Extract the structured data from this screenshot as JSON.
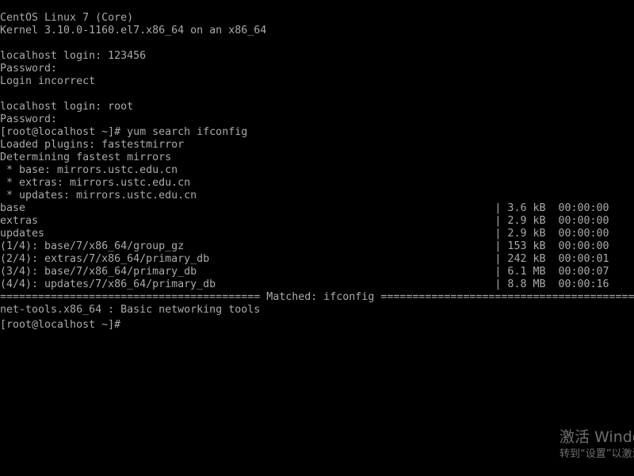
{
  "terminal": {
    "lines": [
      "CentOS Linux 7 (Core)",
      "Kernel 3.10.0-1160.el7.x86_64 on an x86_64",
      "",
      "localhost login: 123456",
      "Password:",
      "Login incorrect",
      "",
      "localhost login: root",
      "Password:",
      "[root@localhost ~]# yum search ifconfig",
      "Loaded plugins: fastestmirror",
      "Determining fastest mirrors",
      " * base: mirrors.ustc.edu.cn",
      " * extras: mirrors.ustc.edu.cn",
      " * updates: mirrors.ustc.edu.cn",
      "base                                                                          | 3.6 kB  00:00:00",
      "extras                                                                        | 2.9 kB  00:00:00",
      "updates                                                                       | 2.9 kB  00:00:00",
      "(1/4): base/7/x86_64/group_gz                                                 | 153 kB  00:00:00",
      "(2/4): extras/7/x86_64/primary_db                                             | 242 kB  00:00:01",
      "(3/4): base/7/x86_64/primary_db                                               | 6.1 MB  00:00:07",
      "(4/4): updates/7/x86_64/primary_db                                            | 8.8 MB  00:00:16",
      "========================================= Matched: ifconfig =========================================",
      "net-tools.x86_64 : Basic networking tools",
      "[root@localhost ~]#"
    ]
  },
  "watermark": {
    "title": "激活 Windows",
    "subtitle": "转到“设置”以激活 Windows。"
  },
  "colors": {
    "background": "#000000",
    "text": "#aaaaaa",
    "watermark": "#6f6f6f"
  }
}
